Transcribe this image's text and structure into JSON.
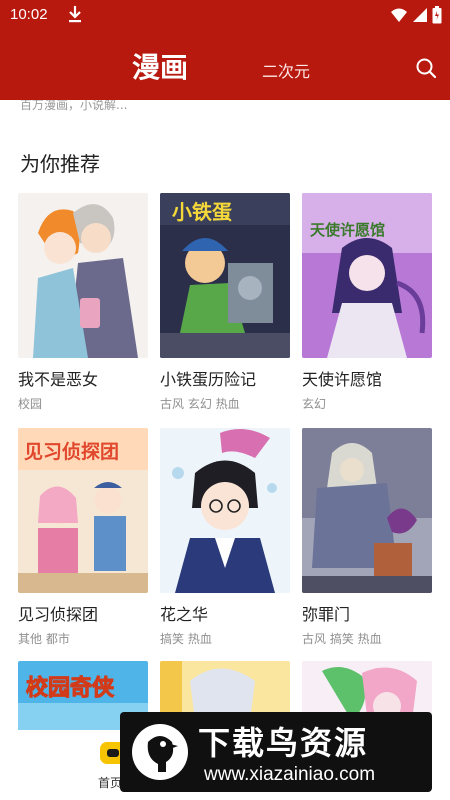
{
  "status_bar": {
    "time": "10:02",
    "icons": [
      "download-icon",
      "wifi-icon",
      "signal-icon",
      "battery-icon"
    ]
  },
  "header": {
    "title": "漫画",
    "tab": "二次元",
    "search_icon": "search-icon"
  },
  "subtitle": "百万漫画，小说解...",
  "section": {
    "title": "为你推荐"
  },
  "comics": [
    {
      "title": "我不是恶女",
      "tags": "校园"
    },
    {
      "title": "小铁蛋历险记",
      "tags": "古风 玄幻 热血"
    },
    {
      "title": "天使许愿馆",
      "tags": "玄幻"
    },
    {
      "title": "见习侦探团",
      "tags": "其他 都市"
    },
    {
      "title": "花之华",
      "tags": "搞笑 热血"
    },
    {
      "title": "弥罪门",
      "tags": "古风 搞笑 热血"
    },
    {
      "title": "",
      "tags": ""
    },
    {
      "title": "",
      "tags": ""
    },
    {
      "title": "",
      "tags": ""
    }
  ],
  "cover_text": {
    "c2": "小铁蛋",
    "c3": "天使许愿馆",
    "c4": "见习侦探团",
    "c7": "校园奇侠"
  },
  "bottom_nav": {
    "home_label": "首页"
  },
  "watermark": {
    "title": "下载鸟资源",
    "url": "www.xiazainiao.com"
  },
  "colors": {
    "brand": "#b8190f",
    "text_primary": "#222222",
    "text_secondary": "#8f8f8f"
  }
}
